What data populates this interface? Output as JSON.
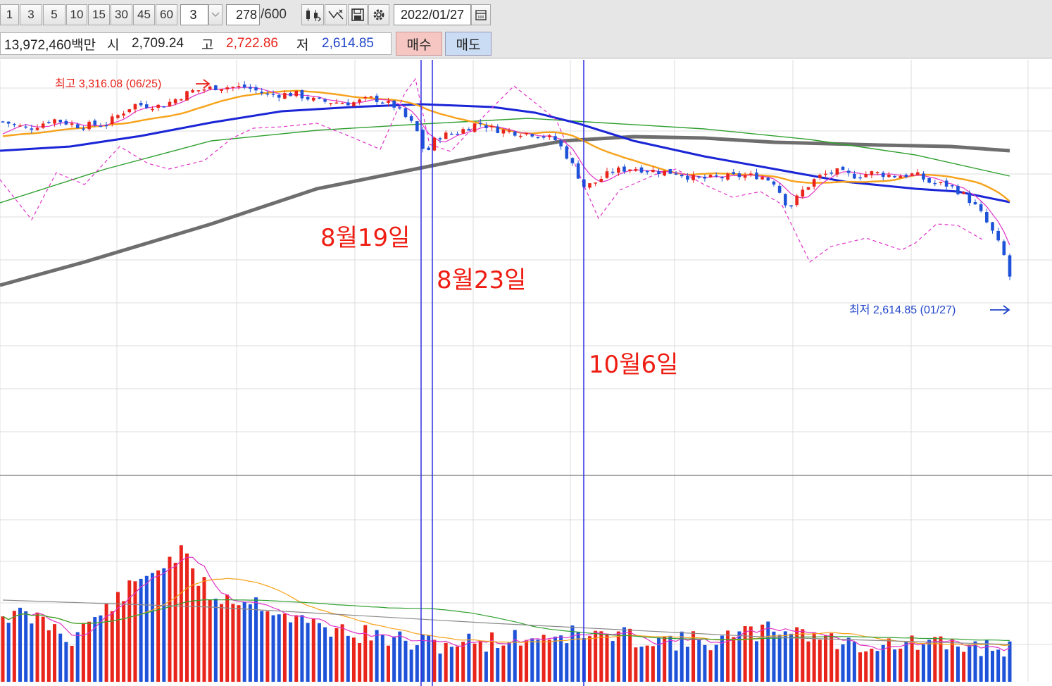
{
  "toolbar": {
    "period_buttons": [
      "1",
      "3",
      "5",
      "10",
      "15",
      "30",
      "45",
      "60"
    ],
    "interval_value": "3",
    "dropdown_icon": "chevron-down-icon",
    "count_value": "278",
    "count_total": "/600",
    "tool_icons": [
      "candle-settings-icon",
      "trend-tool-icon",
      "save-icon",
      "gear-icon"
    ],
    "date_value": "2022/01/27",
    "calendar_icon": "calendar-icon"
  },
  "quote": {
    "volume_label": "13,972,460백만",
    "open_label": "시",
    "open_value": "2,709.24",
    "high_label": "고",
    "high_value": "2,722.86",
    "low_label": "저",
    "low_value": "2,614.85",
    "buy_label": "매수",
    "sell_label": "매도"
  },
  "colors": {
    "up": "#e8241b",
    "down": "#1e52d8",
    "ma_orange": "#f7a21a",
    "ma_blue": "#1a25d6",
    "ma_green": "#30a030",
    "ma_gray": "#6e6e6e",
    "ma_magenta": "#e033c8",
    "marker_line": "#2e2ee0"
  },
  "chart_data": {
    "type": "candlestick",
    "x_range": [
      "2021-05-13",
      "2022-01-27"
    ],
    "price_range_visible": [
      2614.85,
      3316.08
    ],
    "annotations": [
      {
        "text": "최고 3,316.08 (06/25)",
        "value": 3316.08,
        "date": "06/25",
        "color": "#e8241b"
      },
      {
        "text": "최저 2,614.85 (01/27)",
        "value": 2614.85,
        "date": "01/27",
        "color": "#1f44c9"
      }
    ],
    "markers": [
      {
        "label": "8월19일",
        "date": "2021-08-19"
      },
      {
        "label": "8월23일",
        "date": "2021-08-23"
      },
      {
        "label": "10월6일",
        "date": "2021-10-06"
      }
    ],
    "ohlc_last": {
      "date": "2022-01-27",
      "open": 2709.24,
      "high": 2722.86,
      "low": 2614.85
    },
    "moving_averages": [
      "ma_magenta",
      "ma_orange",
      "ma_blue",
      "ma_green",
      "ma_gray"
    ],
    "volume_panel": true,
    "grid": true
  },
  "labels": {
    "marker1": "8월19일",
    "marker2": "8월23일",
    "marker3": "10월6일",
    "high_note": "최고 3,316.08 (06/25)",
    "low_note": "최저 2,614.85 (01/27)"
  }
}
